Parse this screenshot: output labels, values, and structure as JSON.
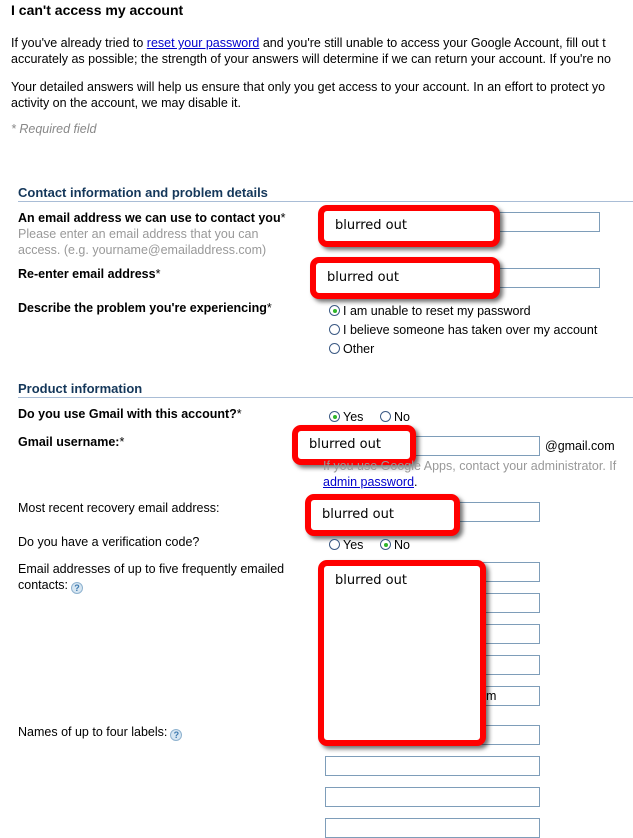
{
  "page": {
    "title": "I can't access my account",
    "intro1_pre": "If you've already tried to ",
    "intro1_link": "reset your password",
    "intro1_post": " and you're still unable to access your Google Account, fill out t",
    "intro1_line2": "accurately as possible; the strength of your answers will determine if we can return your account. If you're no",
    "intro2_line1": "Your detailed answers will help us ensure that only you get access to your account. In an effort to protect yo",
    "intro2_line2": "activity on the account, we may disable it.",
    "required_note": "* Required field"
  },
  "contact": {
    "heading": "Contact information and problem details",
    "email_label": "An email address we can use to contact you",
    "email_hint1": "Please enter an email address that you can",
    "email_hint2": "access. (e.g. yourname@emailaddress.com)",
    "email_value": "blurred out",
    "reenter_label": "Re-enter email address",
    "reenter_value": "blurred out",
    "problem_label": "Describe the problem you're experiencing",
    "problem_options": [
      {
        "label": "I am unable to reset my password",
        "selected": true
      },
      {
        "label": "I believe someone has taken over my account",
        "selected": false
      },
      {
        "label": "Other",
        "selected": false
      }
    ],
    "asterisk": "*"
  },
  "product": {
    "heading": "Product information",
    "gmail_use_label": "Do you use Gmail with this account?",
    "gmail_use_options": [
      {
        "label": "Yes",
        "selected": true
      },
      {
        "label": "No",
        "selected": false
      }
    ],
    "username_label": "Gmail username:",
    "username_value": "blurred out",
    "gmail_suffix": "@gmail.com",
    "apps_hint": "If you use Google Apps, contact your administrator. If",
    "admin_link": "admin password",
    "admin_link_post": ".",
    "recovery_label": "Most recent recovery email address:",
    "recovery_value": "blurred out",
    "verification_label": "Do you have a verification code?",
    "verification_options": [
      {
        "label": "Yes",
        "selected": false
      },
      {
        "label": "No",
        "selected": true
      }
    ],
    "contacts_label1": "Email addresses of up to five frequently emailed",
    "contacts_label2": "contacts:",
    "contacts_value": "blurred out",
    "contacts_partial": "m",
    "labels_label": "Names of up to four labels:",
    "help_glyph": "?"
  }
}
